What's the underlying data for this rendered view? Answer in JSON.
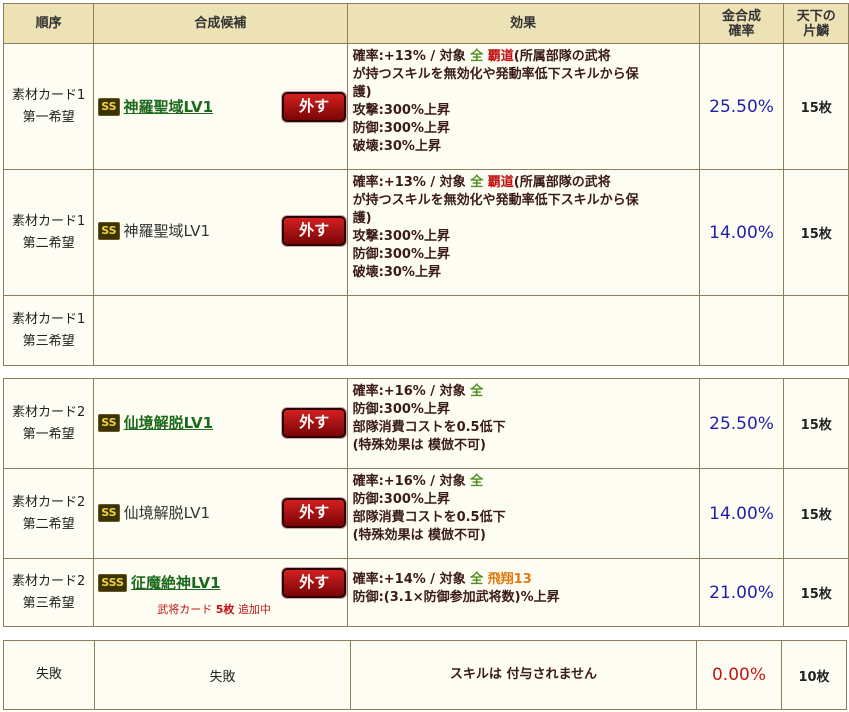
{
  "header": {
    "order": "順序",
    "candidate": "合成候補",
    "effect": "効果",
    "rate_l1": "金合成",
    "rate_l2": "確率",
    "piece_l1": "天下の",
    "piece_l2": "片鱗"
  },
  "remove_label": "外す",
  "group1": [
    {
      "order_l1": "素材カード1",
      "order_l2": "第一希望",
      "rank": "SS",
      "name": "神羅聖域LV1",
      "eff": {
        "l1_pre": "確率:+13%  /  対象  ",
        "all": "全",
        "l1_mid": "  ",
        "hado": "覇道",
        "l1_post": "(所属部隊の武将",
        "l2": "が持つスキルを無効化や発動率低下スキルから保",
        "l3": "護)",
        "l4": "攻撃:300%上昇",
        "l5": "防御:300%上昇",
        "l6": "破壊:30%上昇"
      },
      "rate": "25.50%",
      "pieces": "15枚"
    },
    {
      "order_l1": "素材カード1",
      "order_l2": "第二希望",
      "rank": "SS",
      "name": "神羅聖域LV1",
      "eff": {
        "l1_pre": "確率:+13%  /  対象  ",
        "all": "全",
        "l1_mid": "  ",
        "hado": "覇道",
        "l1_post": "(所属部隊の武将",
        "l2": "が持つスキルを無効化や発動率低下スキルから保",
        "l3": "護)",
        "l4": "攻撃:300%上昇",
        "l5": "防御:300%上昇",
        "l6": "破壊:30%上昇"
      },
      "rate": "14.00%",
      "pieces": "15枚"
    },
    {
      "order_l1": "素材カード1",
      "order_l2": "第三希望"
    }
  ],
  "group2": [
    {
      "order_l1": "素材カード2",
      "order_l2": "第一希望",
      "rank": "SS",
      "name": "仙境解脱LV1",
      "eff": {
        "l1_pre": "確率:+16%  /  対象  ",
        "all": "全",
        "l2": "防御:300%上昇",
        "l3": "部隊消費コストを0.5低下",
        "l4": "(特殊効果は 模倣不可)"
      },
      "rate": "25.50%",
      "pieces": "15枚"
    },
    {
      "order_l1": "素材カード2",
      "order_l2": "第二希望",
      "rank": "SS",
      "name": "仙境解脱LV1",
      "eff": {
        "l1_pre": "確率:+16%  /  対象  ",
        "all": "全",
        "l2": "防御:300%上昇",
        "l3": "部隊消費コストを0.5低下",
        "l4": "(特殊効果は 模倣不可)"
      },
      "rate": "14.00%",
      "pieces": "15枚"
    },
    {
      "order_l1": "素材カード2",
      "order_l2": "第三希望",
      "rank": "SSS",
      "name": "征魔絶神LV1",
      "note_pre": "武将カード ",
      "note_count": "5枚",
      "note_post": " 追加中",
      "eff": {
        "l1_pre": "確率:+14%  /  対象  ",
        "all": "全",
        "l1_mid": "  ",
        "hisho": "飛翔13",
        "l2": "防御:(3.1×防御参加武将数)%上昇"
      },
      "rate": "21.00%",
      "pieces": "15枚"
    }
  ],
  "fail": {
    "order": "失敗",
    "candidate": "失敗",
    "effect": "スキルは 付与されません",
    "rate": "0.00%",
    "pieces": "10枚"
  }
}
